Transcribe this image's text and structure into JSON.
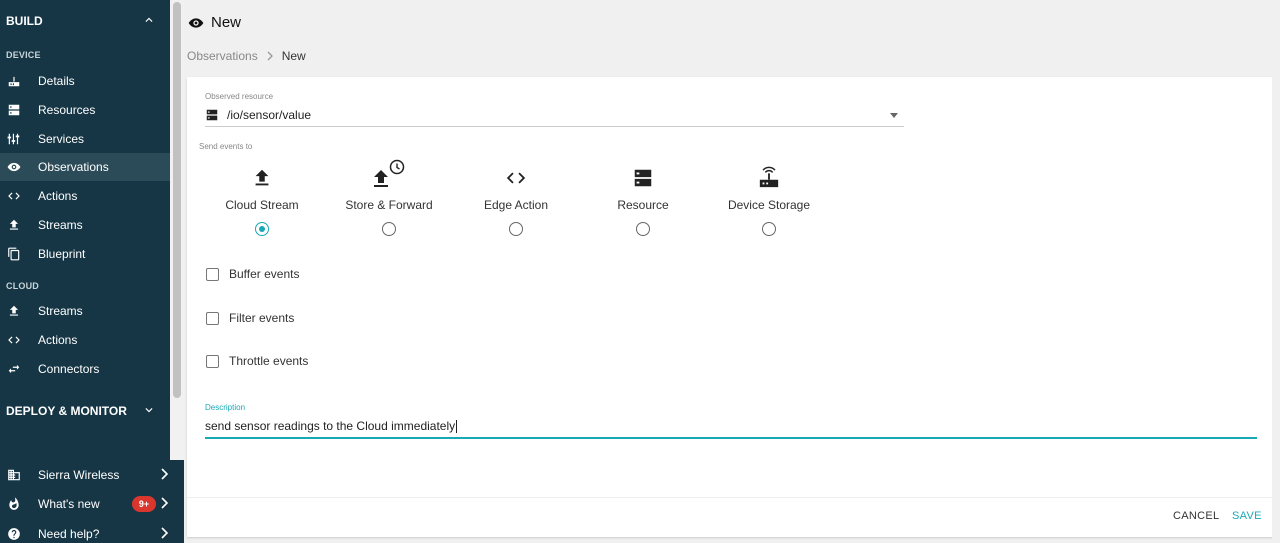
{
  "sidebar": {
    "build_label": "BUILD",
    "device_section": "DEVICE",
    "device_items": [
      {
        "label": "Details",
        "icon": "router-icon"
      },
      {
        "label": "Resources",
        "icon": "dns-icon"
      },
      {
        "label": "Services",
        "icon": "tune-icon"
      },
      {
        "label": "Observations",
        "icon": "eye-icon",
        "active": true
      },
      {
        "label": "Actions",
        "icon": "code-icon"
      },
      {
        "label": "Streams",
        "icon": "upload-icon"
      },
      {
        "label": "Blueprint",
        "icon": "copy-icon"
      }
    ],
    "cloud_section": "CLOUD",
    "cloud_items": [
      {
        "label": "Streams",
        "icon": "upload-icon"
      },
      {
        "label": "Actions",
        "icon": "code-icon"
      },
      {
        "label": "Connectors",
        "icon": "swap-icon"
      }
    ],
    "deploy_label": "DEPLOY & MONITOR",
    "bottom": {
      "company": "Sierra Wireless",
      "whats_new": "What's new",
      "whats_new_badge": "9+",
      "help": "Need help?"
    }
  },
  "page": {
    "title": "New",
    "breadcrumb": [
      "Observations",
      "New"
    ]
  },
  "form": {
    "observed_resource_label": "Observed resource",
    "observed_resource_value": "/io/sensor/value",
    "send_events_label": "Send events to",
    "targets": [
      {
        "label": "Cloud Stream",
        "icon": "upload-icon",
        "selected": true
      },
      {
        "label": "Store & Forward",
        "icon": "upload-clock-icon",
        "selected": false
      },
      {
        "label": "Edge Action",
        "icon": "code-icon",
        "selected": false
      },
      {
        "label": "Resource",
        "icon": "dns-icon",
        "selected": false
      },
      {
        "label": "Device Storage",
        "icon": "router-icon",
        "selected": false
      }
    ],
    "checkboxes": [
      {
        "label": "Buffer events",
        "checked": false
      },
      {
        "label": "Filter events",
        "checked": false
      },
      {
        "label": "Throttle events",
        "checked": false
      }
    ],
    "description_label": "Description",
    "description_value": "send sensor readings to the Cloud immediately"
  },
  "actions": {
    "cancel": "CANCEL",
    "save": "SAVE"
  },
  "colors": {
    "sidebar_bg": "#163645",
    "accent": "#19a9b5",
    "badge": "#d9372e"
  }
}
